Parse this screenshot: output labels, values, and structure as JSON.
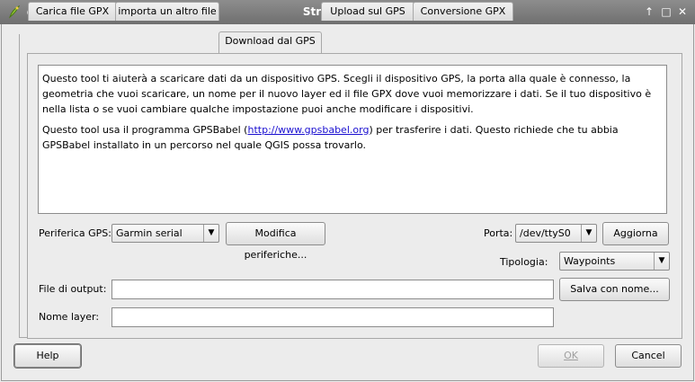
{
  "window": {
    "title": "Strumenti GPS"
  },
  "tabs": [
    {
      "label": "Carica file GPX"
    },
    {
      "label": "importa un altro file"
    },
    {
      "label": "Download dal GPS"
    },
    {
      "label": "Upload sul GPS"
    },
    {
      "label": "Conversione GPX"
    }
  ],
  "info": {
    "para1": "Questo tool ti aiuterà a scaricare dati da un dispositivo GPS. Scegli il dispositivo GPS, la porta alla quale è connesso, la geometria che vuoi scaricare, un nome per il nuovo layer ed il file GPX dove vuoi memorizzare i dati. Se il tuo dispositivo è nella lista o se vuoi cambiare qualche impostazione puoi anche modificare i dispositivi.",
    "para2_pre": "Questo tool usa il programma GPSBabel (",
    "para2_link": "http://www.gpsbabel.org",
    "para2_post": ") per trasferire i dati. Questo richiede che tu abbia GPSBabel installato in un percorso nel quale QGIS possa trovarlo."
  },
  "device": {
    "label": "Periferica GPS:",
    "value": "Garmin serial",
    "edit_button": "Modifica periferiche..."
  },
  "port": {
    "label": "Porta:",
    "value": "/dev/ttyS0",
    "refresh_button": "Aggiorna"
  },
  "feature_type": {
    "label": "Tipologia:",
    "value": "Waypoints"
  },
  "output_file": {
    "label": "File di output:",
    "value": "",
    "save_button": "Salva con nome..."
  },
  "layer_name": {
    "label": "Nome layer:",
    "value": ""
  },
  "footer": {
    "help": "Help",
    "ok": "OK",
    "cancel": "Cancel"
  }
}
